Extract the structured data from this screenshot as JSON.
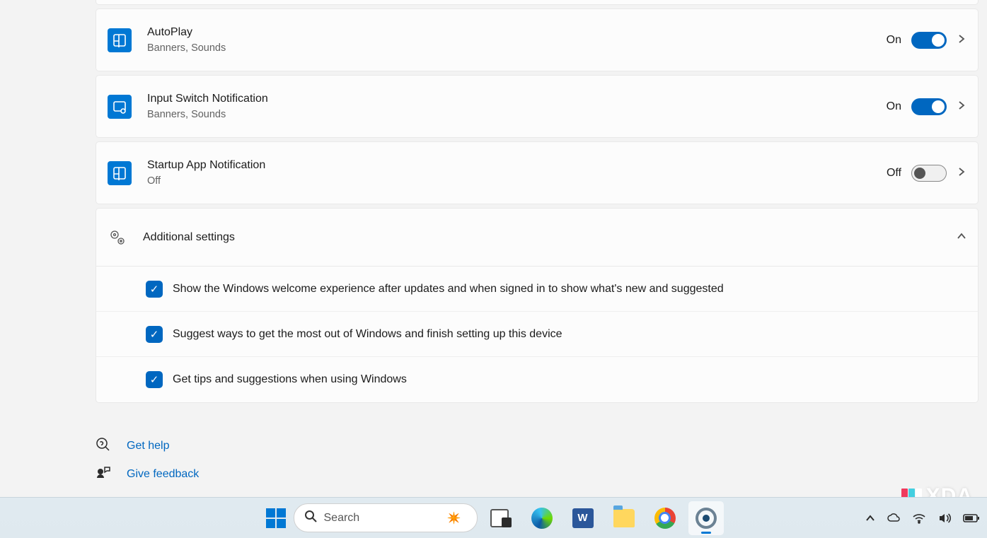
{
  "settings": [
    {
      "icon": "autoplay-icon",
      "title": "AutoPlay",
      "subtitle": "Banners, Sounds",
      "state": "On",
      "on": true
    },
    {
      "icon": "input-switch-icon",
      "title": "Input Switch Notification",
      "subtitle": "Banners, Sounds",
      "state": "On",
      "on": true
    },
    {
      "icon": "startup-app-icon",
      "title": "Startup App Notification",
      "subtitle": "Off",
      "state": "Off",
      "on": false
    }
  ],
  "additional": {
    "header": "Additional settings",
    "checks": [
      "Show the Windows welcome experience after updates and when signed in to show what's new and suggested",
      "Suggest ways to get the most out of Windows and finish setting up this device",
      "Get tips and suggestions when using Windows"
    ]
  },
  "links": {
    "help": "Get help",
    "feedback": "Give feedback"
  },
  "taskbar": {
    "search_placeholder": "Search"
  },
  "watermark": "XDA"
}
